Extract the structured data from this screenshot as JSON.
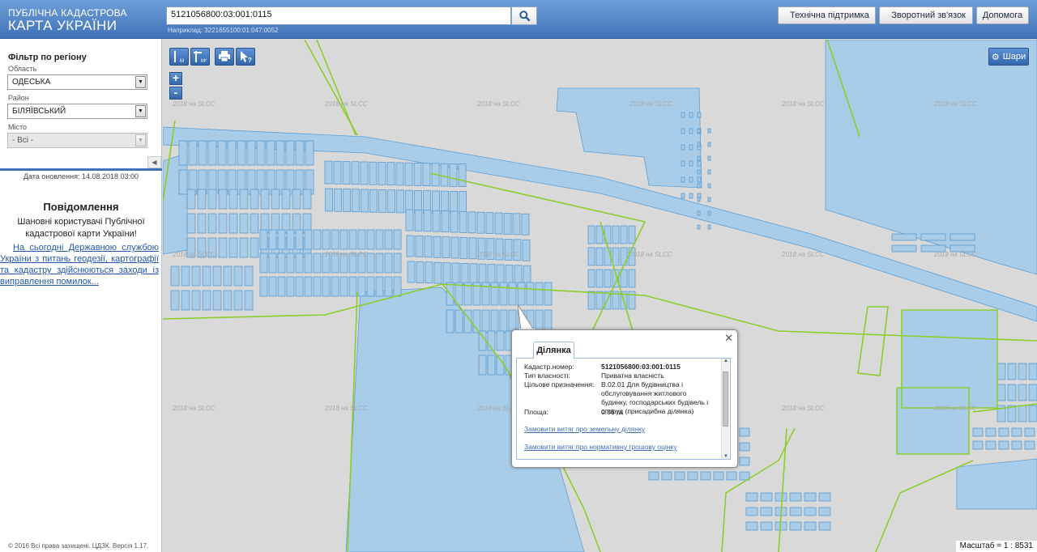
{
  "header": {
    "logo_line1": "ПУБЛІЧНА КАДАСТРОВА",
    "logo_line2": "КАРТА УКРАЇНИ",
    "search_value": "5121056800:03:001:0115",
    "search_hint": "Наприклад: 3221655100:01:047:0052",
    "buttons": {
      "support": "Технічна підтримка",
      "feedback": "Зворотний зв'язок",
      "help": "Допомога"
    }
  },
  "sidebar": {
    "title": "Фільтр по регіону",
    "oblast_label": "Область",
    "oblast_value": "ОДЕСЬКА",
    "raion_label": "Район",
    "raion_value": "БІЛЯЇВСЬКИЙ",
    "misto_label": "Місто",
    "misto_value": "- Всі -",
    "update_date": "Дата оновлення: 14.08.2018 03:00",
    "notice_title": "Повідомлення",
    "notice_text": "Шановні користувачі Публічної кадастрової карти України!",
    "notice_link": "На сьогодні Державною службою України з питань геодезії, картографії та кадастру здійснюються заходи із виправлення помилок...",
    "footer": "© 2016 Всі права захищені. ЦДЗК. Версія 1.17."
  },
  "map": {
    "toolbar": {
      "measure_line": "M",
      "measure_area": "M²"
    },
    "zoom_in": "+",
    "zoom_out": "-",
    "layers_label": "Шари",
    "watermark": "2018 на SLCC",
    "scale_text": "Масштаб = 1 : 8531",
    "colors": {
      "parcel_fill": "#a9cde9",
      "parcel_stroke": "#5d9fd4",
      "boundary": "#8ccd2c",
      "background": "#d9d9d9"
    }
  },
  "popup": {
    "tab_label": "Ділянка",
    "rows": [
      {
        "key": "Кадастр.номер:",
        "value": "5121056800:03:001:0115"
      },
      {
        "key": "Тип власності:",
        "value": "Приватна власність"
      },
      {
        "key": "Цільове призначення:",
        "value": "В.02.01 Для будівництва і обслуговування житлового будинку, господарських будівель і споруд (присадибна ділянка)"
      },
      {
        "key": "Площа:",
        "value": "0.06 га"
      }
    ],
    "link1": "Замовити витяг про земельну ділянку",
    "link2": "Замовити витяг про нормативну грошову оцінку"
  }
}
